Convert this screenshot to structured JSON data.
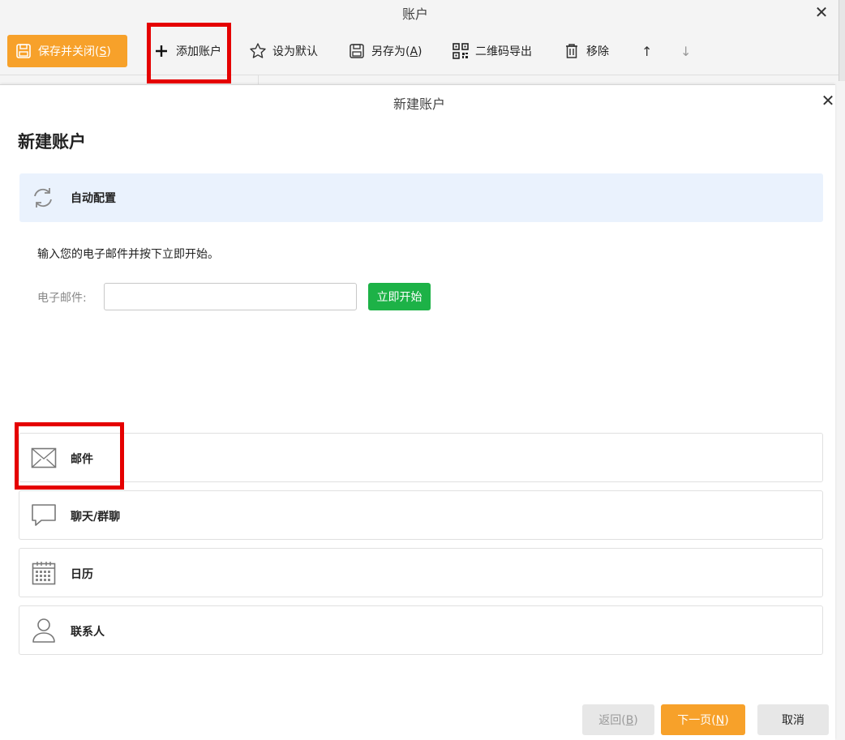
{
  "outer_window": {
    "title": "账户",
    "close_symbol": "✕",
    "toolbar": {
      "save_close": {
        "label": "保存并关闭(",
        "key": "S",
        "suffix": ")"
      },
      "add_account": "添加账户",
      "set_default": "设为默认",
      "save_as": {
        "label": "另存为(",
        "key": "A",
        "suffix": ")"
      },
      "qr_export": "二维码导出",
      "remove": "移除",
      "move_up": "↑",
      "move_down": "↓"
    }
  },
  "dialog": {
    "title": "新建账户",
    "close_symbol": "✕",
    "heading": "新建账户",
    "auto_config": {
      "label": "自动配置",
      "hint": "输入您的电子邮件并按下立即开始。",
      "email_label": "电子邮件:",
      "email_value": "",
      "start_button": "立即开始"
    },
    "account_types": [
      {
        "label": "邮件",
        "icon": "mail-icon"
      },
      {
        "label": "聊天/群聊",
        "icon": "chat-icon"
      },
      {
        "label": "日历",
        "icon": "calendar-icon"
      },
      {
        "label": "联系人",
        "icon": "contact-icon"
      }
    ],
    "footer": {
      "back": {
        "label": "返回(",
        "key": "B",
        "suffix": ")"
      },
      "next": {
        "label": "下一页(",
        "key": "N",
        "suffix": ")"
      },
      "cancel": "取消"
    }
  },
  "colors": {
    "accent_orange": "#f7a12a",
    "start_green": "#1db247",
    "highlight_red": "#e50000",
    "auto_panel_bg": "#eaf2fd"
  }
}
